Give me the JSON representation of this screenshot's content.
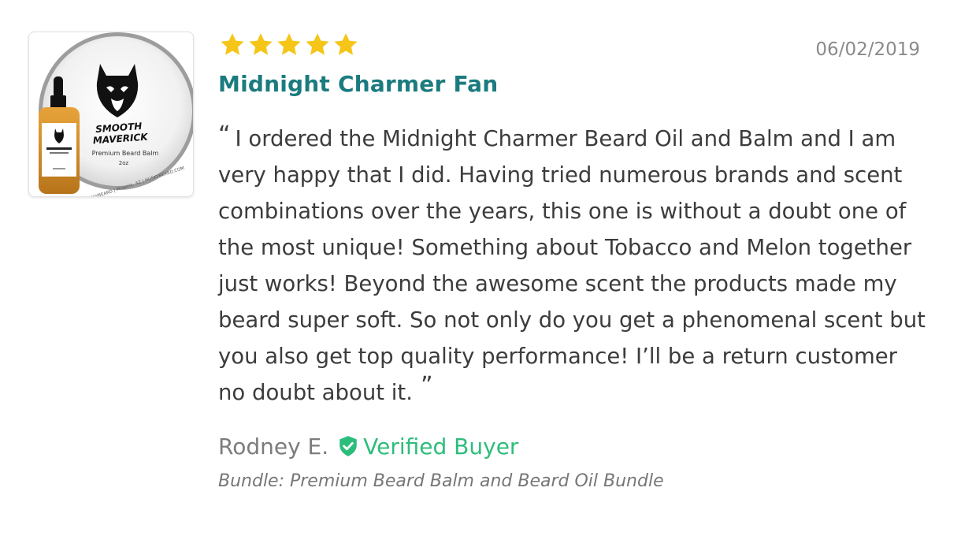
{
  "review": {
    "rating": 5,
    "rating_max": 5,
    "date": "06/02/2019",
    "title": "Midnight Charmer Fan",
    "open_quote": "“",
    "body": "I ordered the Midnight Charmer Beard Oil and Balm and I am very happy that I did. Having tried numerous brands and scent combinations over the years, this one is without a doubt one of the most unique! Something about Tobacco and Melon together just works! Beyond the awesome scent the products made my beard super soft. So not only do you get a phenomenal scent but you also get top quality performance! I’ll be a return customer no doubt about it.",
    "close_quote": "”",
    "author": "Rodney E.",
    "verified_label": "Verified Buyer",
    "bundle": "Bundle: Premium Beard Balm and Beard Oil Bundle"
  },
  "product_image": {
    "brand_line1": "SMOOTH",
    "brand_line2": "MAVERICK",
    "product_name": "Premium Beard Balm",
    "size": "2oz",
    "rim_text": "HUSKYBEARD | Phoenix, AZ | HUSKYBEARD.COM"
  },
  "colors": {
    "star": "#f5c518",
    "title": "#1b7b7f",
    "verified": "#2dbd7b",
    "body_text": "#3c3c3c",
    "muted": "#8a8a8a"
  },
  "icons": {
    "star": "star-icon",
    "verified": "shield-check-icon"
  }
}
